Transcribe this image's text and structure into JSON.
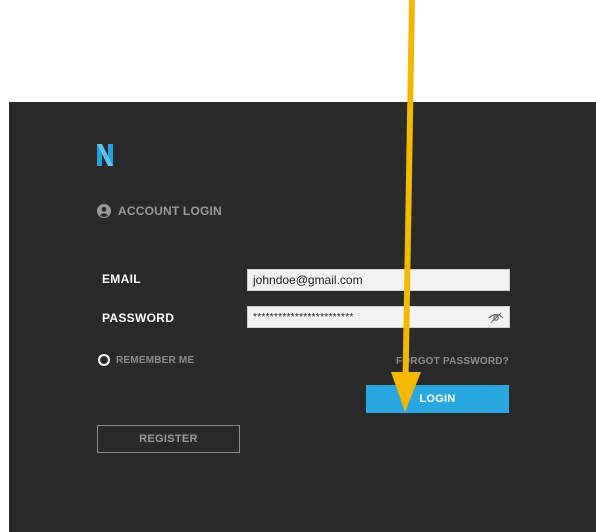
{
  "login": {
    "account_title": "ACCOUNT LOGIN",
    "email_label": "EMAIL",
    "email_value": "johndoe@gmail.com",
    "password_label": "PASSWORD",
    "password_value": "************************",
    "remember_label": "REMEMBER ME",
    "forgot_label": "FORGOT PASSWORD?",
    "login_label": "LOGIN",
    "register_label": "REGISTER"
  },
  "icons": {
    "logo": "n-logo-icon",
    "user": "user-circle-icon",
    "password_toggle": "eye-icon",
    "remember": "radio-icon",
    "annotation": "arrow-down-icon"
  },
  "colors": {
    "panel_bg": "#2a2a2a",
    "accent": "#29a8e0",
    "logo": "#2a9fe0",
    "annotation_arrow": "#f5b800"
  }
}
